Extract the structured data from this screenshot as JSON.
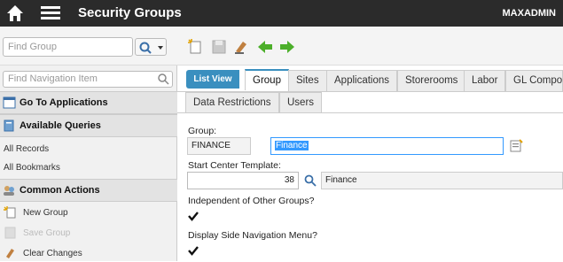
{
  "header": {
    "title": "Security Groups",
    "user": "MAXADMIN"
  },
  "toolbar": {
    "find_placeholder": "Find Group",
    "icons": [
      "new-record-icon",
      "save-icon",
      "clear-changes-icon",
      "previous-record-icon",
      "next-record-icon"
    ]
  },
  "sidebar": {
    "find_nav_placeholder": "Find Navigation Item",
    "go_to_applications": "Go To Applications",
    "available_queries": "Available Queries",
    "queries": [
      "All Records",
      "All Bookmarks"
    ],
    "common_actions": "Common Actions",
    "actions": [
      {
        "label": "New Group",
        "enabled": true
      },
      {
        "label": "Save Group",
        "enabled": false
      },
      {
        "label": "Clear Changes",
        "enabled": true
      }
    ]
  },
  "tabs": {
    "list_view": "List View",
    "row1": [
      "Group",
      "Sites",
      "Applications",
      "Storerooms",
      "Labor",
      "GL Compon"
    ],
    "row2": [
      "Data Restrictions",
      "Users"
    ],
    "active": "Group"
  },
  "form": {
    "group_label": "Group:",
    "group_value": "FINANCE",
    "group_description": "Finance",
    "start_center_label": "Start Center Template:",
    "start_center_value": "38",
    "start_center_description": "Finance",
    "independent_label": "Independent of Other Groups?",
    "independent_checked": true,
    "side_nav_label": "Display Side Navigation Menu?",
    "side_nav_checked": true
  },
  "colors": {
    "topbar": "#2b2b2b",
    "accent": "#3a8fbf",
    "highlight": "#3399ff"
  }
}
